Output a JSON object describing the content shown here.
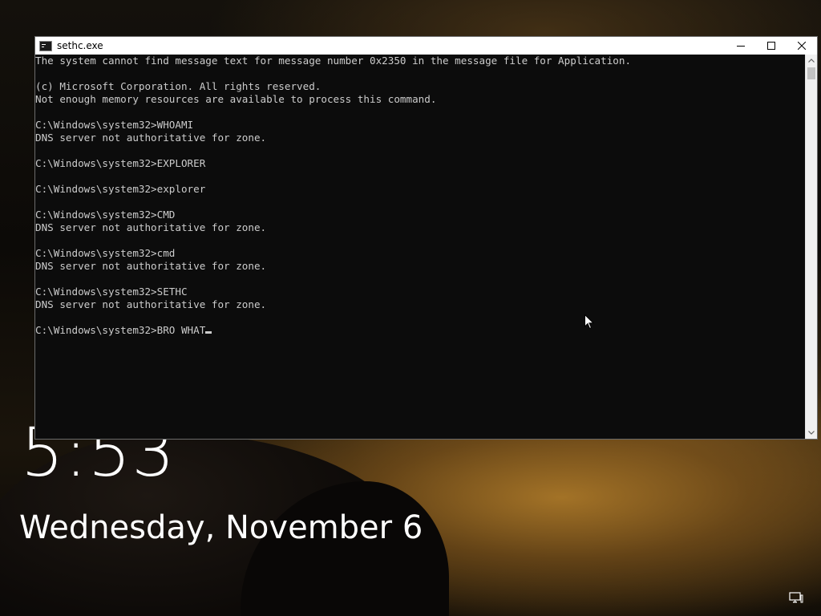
{
  "lockscreen": {
    "time": "5:53",
    "date": "Wednesday, November 6",
    "network_icon": "network-icon"
  },
  "window": {
    "title": "sethc.exe",
    "app_icon": "console-icon",
    "controls": {
      "minimize_icon": "minimize-icon",
      "maximize_icon": "maximize-icon",
      "close_icon": "close-icon"
    }
  },
  "console": {
    "lines": [
      "The system cannot find message text for message number 0x2350 in the message file for Application.",
      "",
      "(c) Microsoft Corporation. All rights reserved.",
      "Not enough memory resources are available to process this command.",
      "",
      "C:\\Windows\\system32>WHOAMI",
      "DNS server not authoritative for zone.",
      "",
      "C:\\Windows\\system32>EXPLORER",
      "",
      "C:\\Windows\\system32>explorer",
      "",
      "C:\\Windows\\system32>CMD",
      "DNS server not authoritative for zone.",
      "",
      "C:\\Windows\\system32>cmd",
      "DNS server not authoritative for zone.",
      "",
      "C:\\Windows\\system32>SETHC",
      "DNS server not authoritative for zone.",
      ""
    ],
    "current_prompt": "C:\\Windows\\system32>BRO WHAT"
  },
  "colors": {
    "console_bg": "#0c0c0c",
    "console_text": "#cccccc",
    "titlebar_bg": "#ffffff"
  }
}
